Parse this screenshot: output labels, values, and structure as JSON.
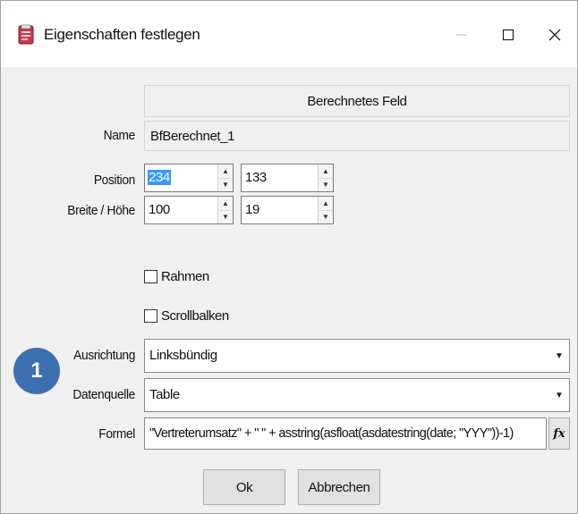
{
  "window": {
    "title": "Eigenschaften festlegen",
    "icons": {
      "app": "form-properties-icon",
      "minimize": "minimize-icon",
      "maximize": "maximize-icon",
      "close": "close-icon"
    }
  },
  "form": {
    "header": "Berechnetes Feld",
    "name_label": "Name",
    "name_value": "BfBerechnet_1",
    "position_label": "Position",
    "position_x": "234",
    "position_y": "133",
    "size_label": "Breite / Höhe",
    "width": "100",
    "height": "19",
    "rahmen_label": "Rahmen",
    "scroll_label": "Scrollbalken",
    "ausrichtung_label": "Ausrichtung",
    "ausrichtung_value": "Linksbündig",
    "datenquelle_label": "Datenquelle",
    "datenquelle_value": "Table",
    "formel_label": "Formel",
    "formel_value": "\"Vertreterumsatz\" + \" \" + asstring(asfloat(asdatestring(date; \"YYY\"))-1)",
    "fx_label": "fx"
  },
  "buttons": {
    "ok": "Ok",
    "cancel": "Abbrechen"
  },
  "badge": "1",
  "colors": {
    "badge": "#3c6fb0",
    "selection": "#3399ff"
  }
}
